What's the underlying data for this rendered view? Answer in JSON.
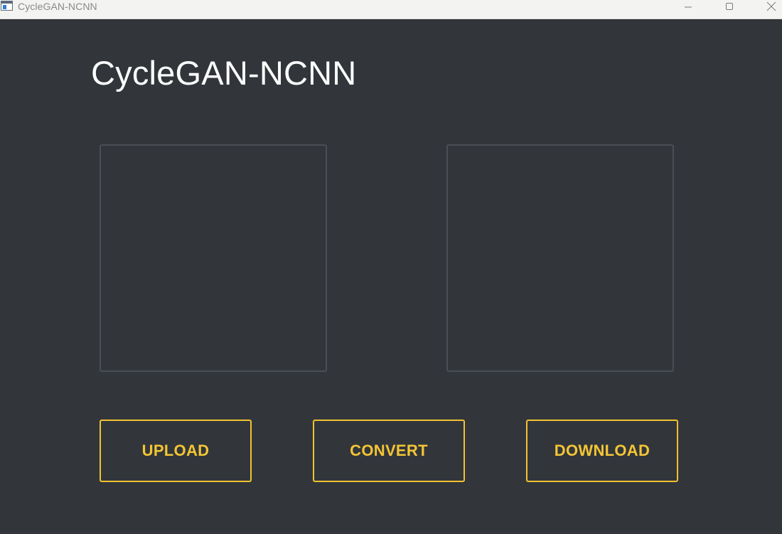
{
  "window": {
    "title": "CycleGAN-NCNN",
    "icon": "app-window-icon",
    "controls": {
      "minimize_icon": "minimize-icon",
      "maximize_icon": "maximize-icon",
      "close_icon": "close-icon"
    }
  },
  "app": {
    "heading": "CycleGAN-NCNN"
  },
  "panels": {
    "input": {
      "content": ""
    },
    "output": {
      "content": ""
    }
  },
  "actions": {
    "upload_label": "UPLOAD",
    "convert_label": "CONVERT",
    "download_label": "DOWNLOAD"
  },
  "colors": {
    "background": "#32363b",
    "titlebar": "#f3f3f1",
    "accent": "#f2c230",
    "panel_border": "#4a4f55",
    "heading_text": "#ffffff"
  }
}
